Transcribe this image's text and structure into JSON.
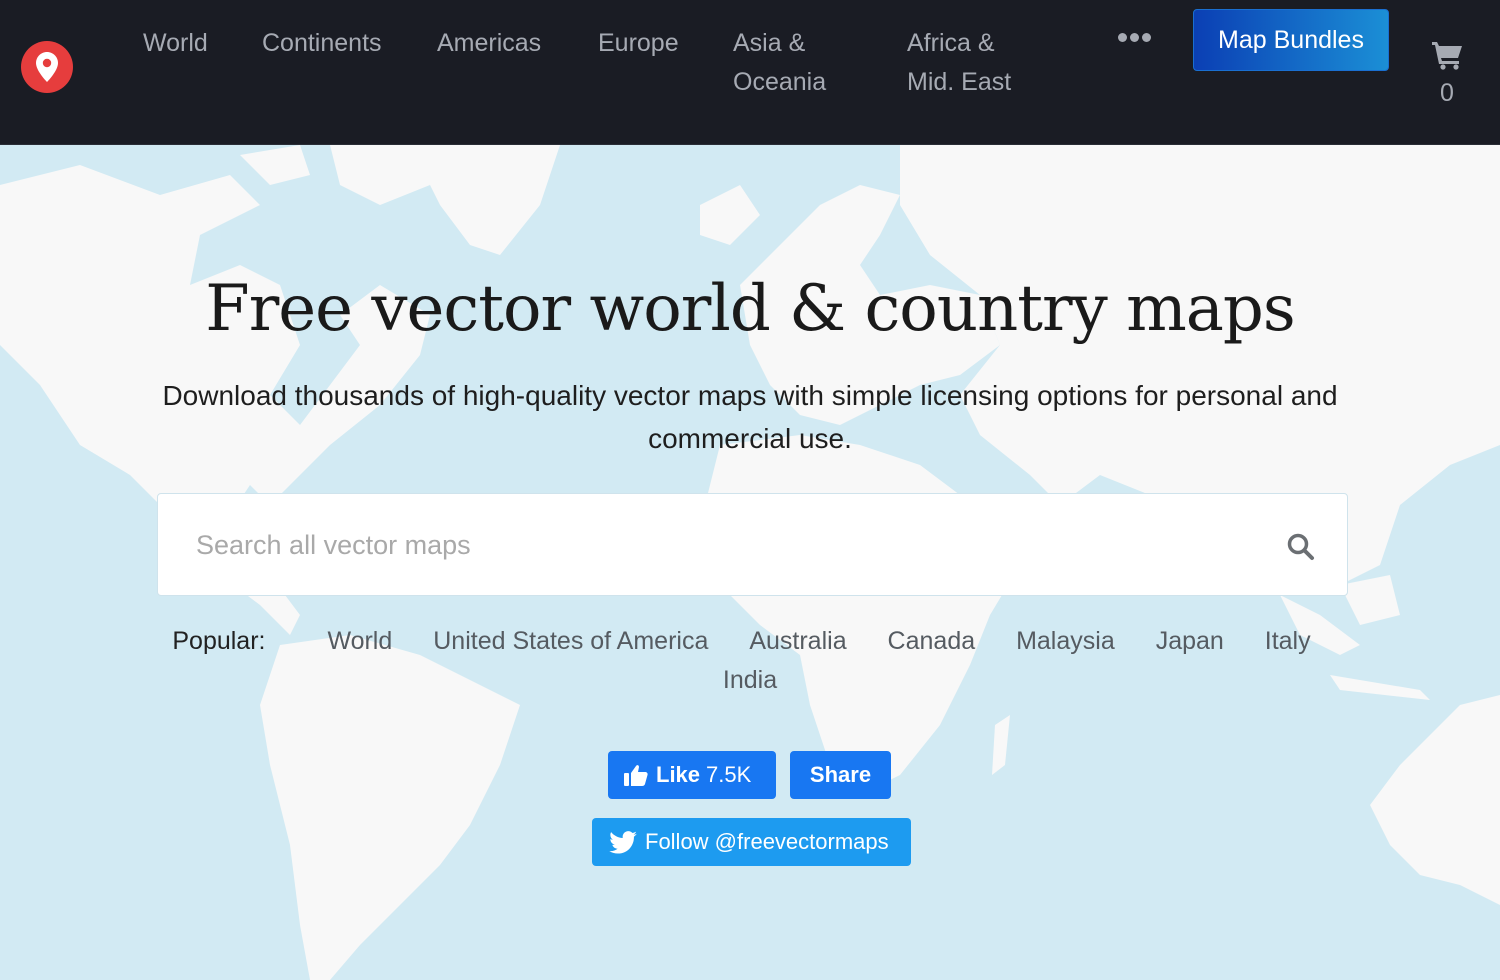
{
  "nav": {
    "logo_icon": "map-pin-icon",
    "items": [
      {
        "label": "World"
      },
      {
        "label": "Continents"
      },
      {
        "label": "Americas"
      },
      {
        "label": "Europe"
      },
      {
        "label": "Asia &",
        "label2": "Oceania"
      },
      {
        "label": "Africa &",
        "label2": "Mid. East"
      }
    ],
    "more_icon": "ellipsis-icon",
    "bundles_label": "Map Bundles",
    "cart_icon": "shopping-cart-icon",
    "cart_count": "0"
  },
  "hero": {
    "title": "Free vector world & country maps",
    "subtitle": "Download thousands of high-quality vector maps with simple licensing options for personal and commercial use."
  },
  "search": {
    "placeholder": "Search all vector maps",
    "value": "",
    "icon": "search-icon"
  },
  "popular": {
    "label": "Popular:",
    "links": [
      "World",
      "United States of America",
      "Australia",
      "Canada",
      "Malaysia",
      "Japan",
      "Italy",
      "India"
    ]
  },
  "social": {
    "like_label": "Like",
    "like_count": "7.5K",
    "share_label": "Share",
    "follow_label": "Follow @freevectormaps"
  },
  "colors": {
    "nav_bg": "#1a1c24",
    "logo_red": "#e63d3d",
    "ocean": "#d2eaf3",
    "land": "#f8f8f8",
    "facebook": "#1877f2",
    "twitter": "#1d9bf0"
  }
}
